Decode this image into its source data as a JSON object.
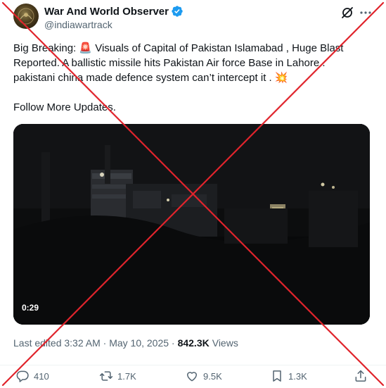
{
  "account": {
    "display_name": "War And World Observer",
    "handle": "@indiawartrack",
    "verified": true
  },
  "header_icons": [
    "grok-icon",
    "more-icon"
  ],
  "tweet": {
    "line1": "Big Breaking: 🚨 Visuals of Capital of Pakistan Islamabad , Huge Blast Reported. A ballistic missile hits Pakistan Air force Base in Lahore . pakistani china made defence system can’t intercept it . 💥",
    "line2": "Follow More Updates."
  },
  "video": {
    "duration": "0:29"
  },
  "meta": {
    "text": "Last edited 3:32 AM · May 10, 2025 ·",
    "views_count": "842.3K",
    "views_label": "Views"
  },
  "actions": {
    "replies": "410",
    "reposts": "1.7K",
    "likes": "9.5K",
    "bookmarks": "1.3K"
  },
  "colors": {
    "overlay_x": "#e0242c",
    "verified": "#1d9bf0",
    "secondary_text": "#536471"
  }
}
